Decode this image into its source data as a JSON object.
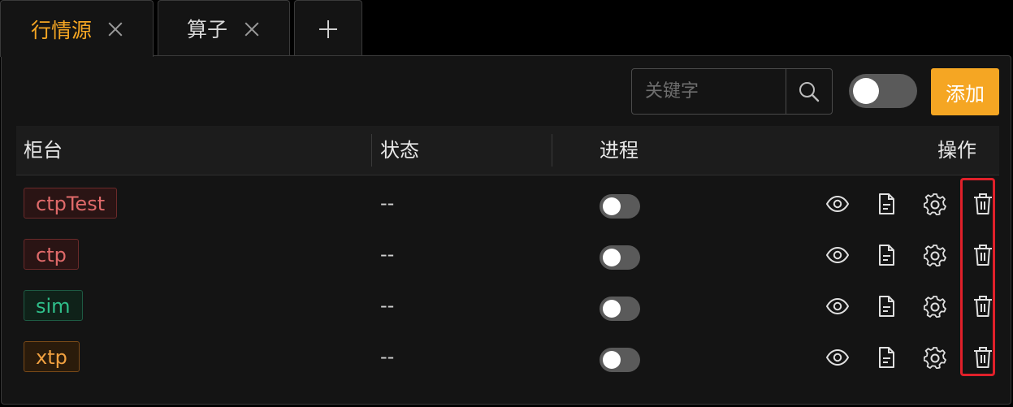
{
  "tabs": [
    {
      "label": "行情源",
      "active": true
    },
    {
      "label": "算子",
      "active": false
    }
  ],
  "toolbar": {
    "search_placeholder": "关键字",
    "add_label": "添加"
  },
  "table": {
    "columns": [
      "柜台",
      "状态",
      "进程",
      "操作"
    ],
    "rows": [
      {
        "name": "ctpTest",
        "tag_color": "red",
        "status": "--",
        "process_on": false
      },
      {
        "name": "ctp",
        "tag_color": "red",
        "status": "--",
        "process_on": false
      },
      {
        "name": "sim",
        "tag_color": "green",
        "status": "--",
        "process_on": false
      },
      {
        "name": "xtp",
        "tag_color": "orange",
        "status": "--",
        "process_on": false
      }
    ],
    "row_actions": [
      "view-icon",
      "file-icon",
      "gear-icon",
      "trash-icon"
    ]
  },
  "colors": {
    "accent": "#f5a623",
    "highlight": "#e0202a",
    "background": "#141414"
  }
}
